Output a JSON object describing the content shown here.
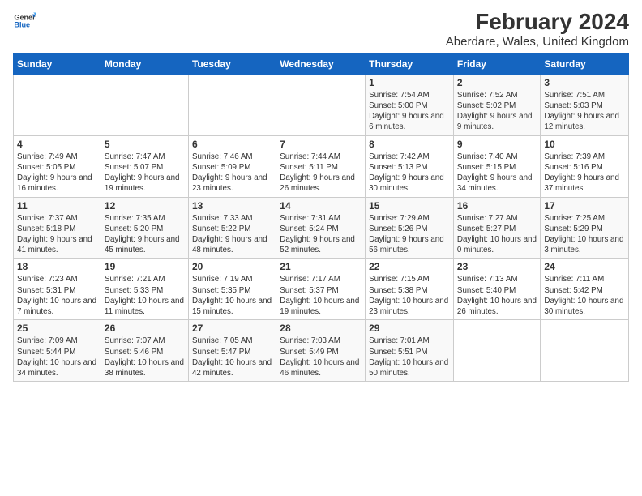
{
  "logo": {
    "line1": "General",
    "line2": "Blue"
  },
  "title": "February 2024",
  "subtitle": "Aberdare, Wales, United Kingdom",
  "weekdays": [
    "Sunday",
    "Monday",
    "Tuesday",
    "Wednesday",
    "Thursday",
    "Friday",
    "Saturday"
  ],
  "weeks": [
    [
      {
        "day": "",
        "info": ""
      },
      {
        "day": "",
        "info": ""
      },
      {
        "day": "",
        "info": ""
      },
      {
        "day": "",
        "info": ""
      },
      {
        "day": "1",
        "info": "Sunrise: 7:54 AM\nSunset: 5:00 PM\nDaylight: 9 hours and 6 minutes."
      },
      {
        "day": "2",
        "info": "Sunrise: 7:52 AM\nSunset: 5:02 PM\nDaylight: 9 hours and 9 minutes."
      },
      {
        "day": "3",
        "info": "Sunrise: 7:51 AM\nSunset: 5:03 PM\nDaylight: 9 hours and 12 minutes."
      }
    ],
    [
      {
        "day": "4",
        "info": "Sunrise: 7:49 AM\nSunset: 5:05 PM\nDaylight: 9 hours and 16 minutes."
      },
      {
        "day": "5",
        "info": "Sunrise: 7:47 AM\nSunset: 5:07 PM\nDaylight: 9 hours and 19 minutes."
      },
      {
        "day": "6",
        "info": "Sunrise: 7:46 AM\nSunset: 5:09 PM\nDaylight: 9 hours and 23 minutes."
      },
      {
        "day": "7",
        "info": "Sunrise: 7:44 AM\nSunset: 5:11 PM\nDaylight: 9 hours and 26 minutes."
      },
      {
        "day": "8",
        "info": "Sunrise: 7:42 AM\nSunset: 5:13 PM\nDaylight: 9 hours and 30 minutes."
      },
      {
        "day": "9",
        "info": "Sunrise: 7:40 AM\nSunset: 5:15 PM\nDaylight: 9 hours and 34 minutes."
      },
      {
        "day": "10",
        "info": "Sunrise: 7:39 AM\nSunset: 5:16 PM\nDaylight: 9 hours and 37 minutes."
      }
    ],
    [
      {
        "day": "11",
        "info": "Sunrise: 7:37 AM\nSunset: 5:18 PM\nDaylight: 9 hours and 41 minutes."
      },
      {
        "day": "12",
        "info": "Sunrise: 7:35 AM\nSunset: 5:20 PM\nDaylight: 9 hours and 45 minutes."
      },
      {
        "day": "13",
        "info": "Sunrise: 7:33 AM\nSunset: 5:22 PM\nDaylight: 9 hours and 48 minutes."
      },
      {
        "day": "14",
        "info": "Sunrise: 7:31 AM\nSunset: 5:24 PM\nDaylight: 9 hours and 52 minutes."
      },
      {
        "day": "15",
        "info": "Sunrise: 7:29 AM\nSunset: 5:26 PM\nDaylight: 9 hours and 56 minutes."
      },
      {
        "day": "16",
        "info": "Sunrise: 7:27 AM\nSunset: 5:27 PM\nDaylight: 10 hours and 0 minutes."
      },
      {
        "day": "17",
        "info": "Sunrise: 7:25 AM\nSunset: 5:29 PM\nDaylight: 10 hours and 3 minutes."
      }
    ],
    [
      {
        "day": "18",
        "info": "Sunrise: 7:23 AM\nSunset: 5:31 PM\nDaylight: 10 hours and 7 minutes."
      },
      {
        "day": "19",
        "info": "Sunrise: 7:21 AM\nSunset: 5:33 PM\nDaylight: 10 hours and 11 minutes."
      },
      {
        "day": "20",
        "info": "Sunrise: 7:19 AM\nSunset: 5:35 PM\nDaylight: 10 hours and 15 minutes."
      },
      {
        "day": "21",
        "info": "Sunrise: 7:17 AM\nSunset: 5:37 PM\nDaylight: 10 hours and 19 minutes."
      },
      {
        "day": "22",
        "info": "Sunrise: 7:15 AM\nSunset: 5:38 PM\nDaylight: 10 hours and 23 minutes."
      },
      {
        "day": "23",
        "info": "Sunrise: 7:13 AM\nSunset: 5:40 PM\nDaylight: 10 hours and 26 minutes."
      },
      {
        "day": "24",
        "info": "Sunrise: 7:11 AM\nSunset: 5:42 PM\nDaylight: 10 hours and 30 minutes."
      }
    ],
    [
      {
        "day": "25",
        "info": "Sunrise: 7:09 AM\nSunset: 5:44 PM\nDaylight: 10 hours and 34 minutes."
      },
      {
        "day": "26",
        "info": "Sunrise: 7:07 AM\nSunset: 5:46 PM\nDaylight: 10 hours and 38 minutes."
      },
      {
        "day": "27",
        "info": "Sunrise: 7:05 AM\nSunset: 5:47 PM\nDaylight: 10 hours and 42 minutes."
      },
      {
        "day": "28",
        "info": "Sunrise: 7:03 AM\nSunset: 5:49 PM\nDaylight: 10 hours and 46 minutes."
      },
      {
        "day": "29",
        "info": "Sunrise: 7:01 AM\nSunset: 5:51 PM\nDaylight: 10 hours and 50 minutes."
      },
      {
        "day": "",
        "info": ""
      },
      {
        "day": "",
        "info": ""
      }
    ]
  ]
}
